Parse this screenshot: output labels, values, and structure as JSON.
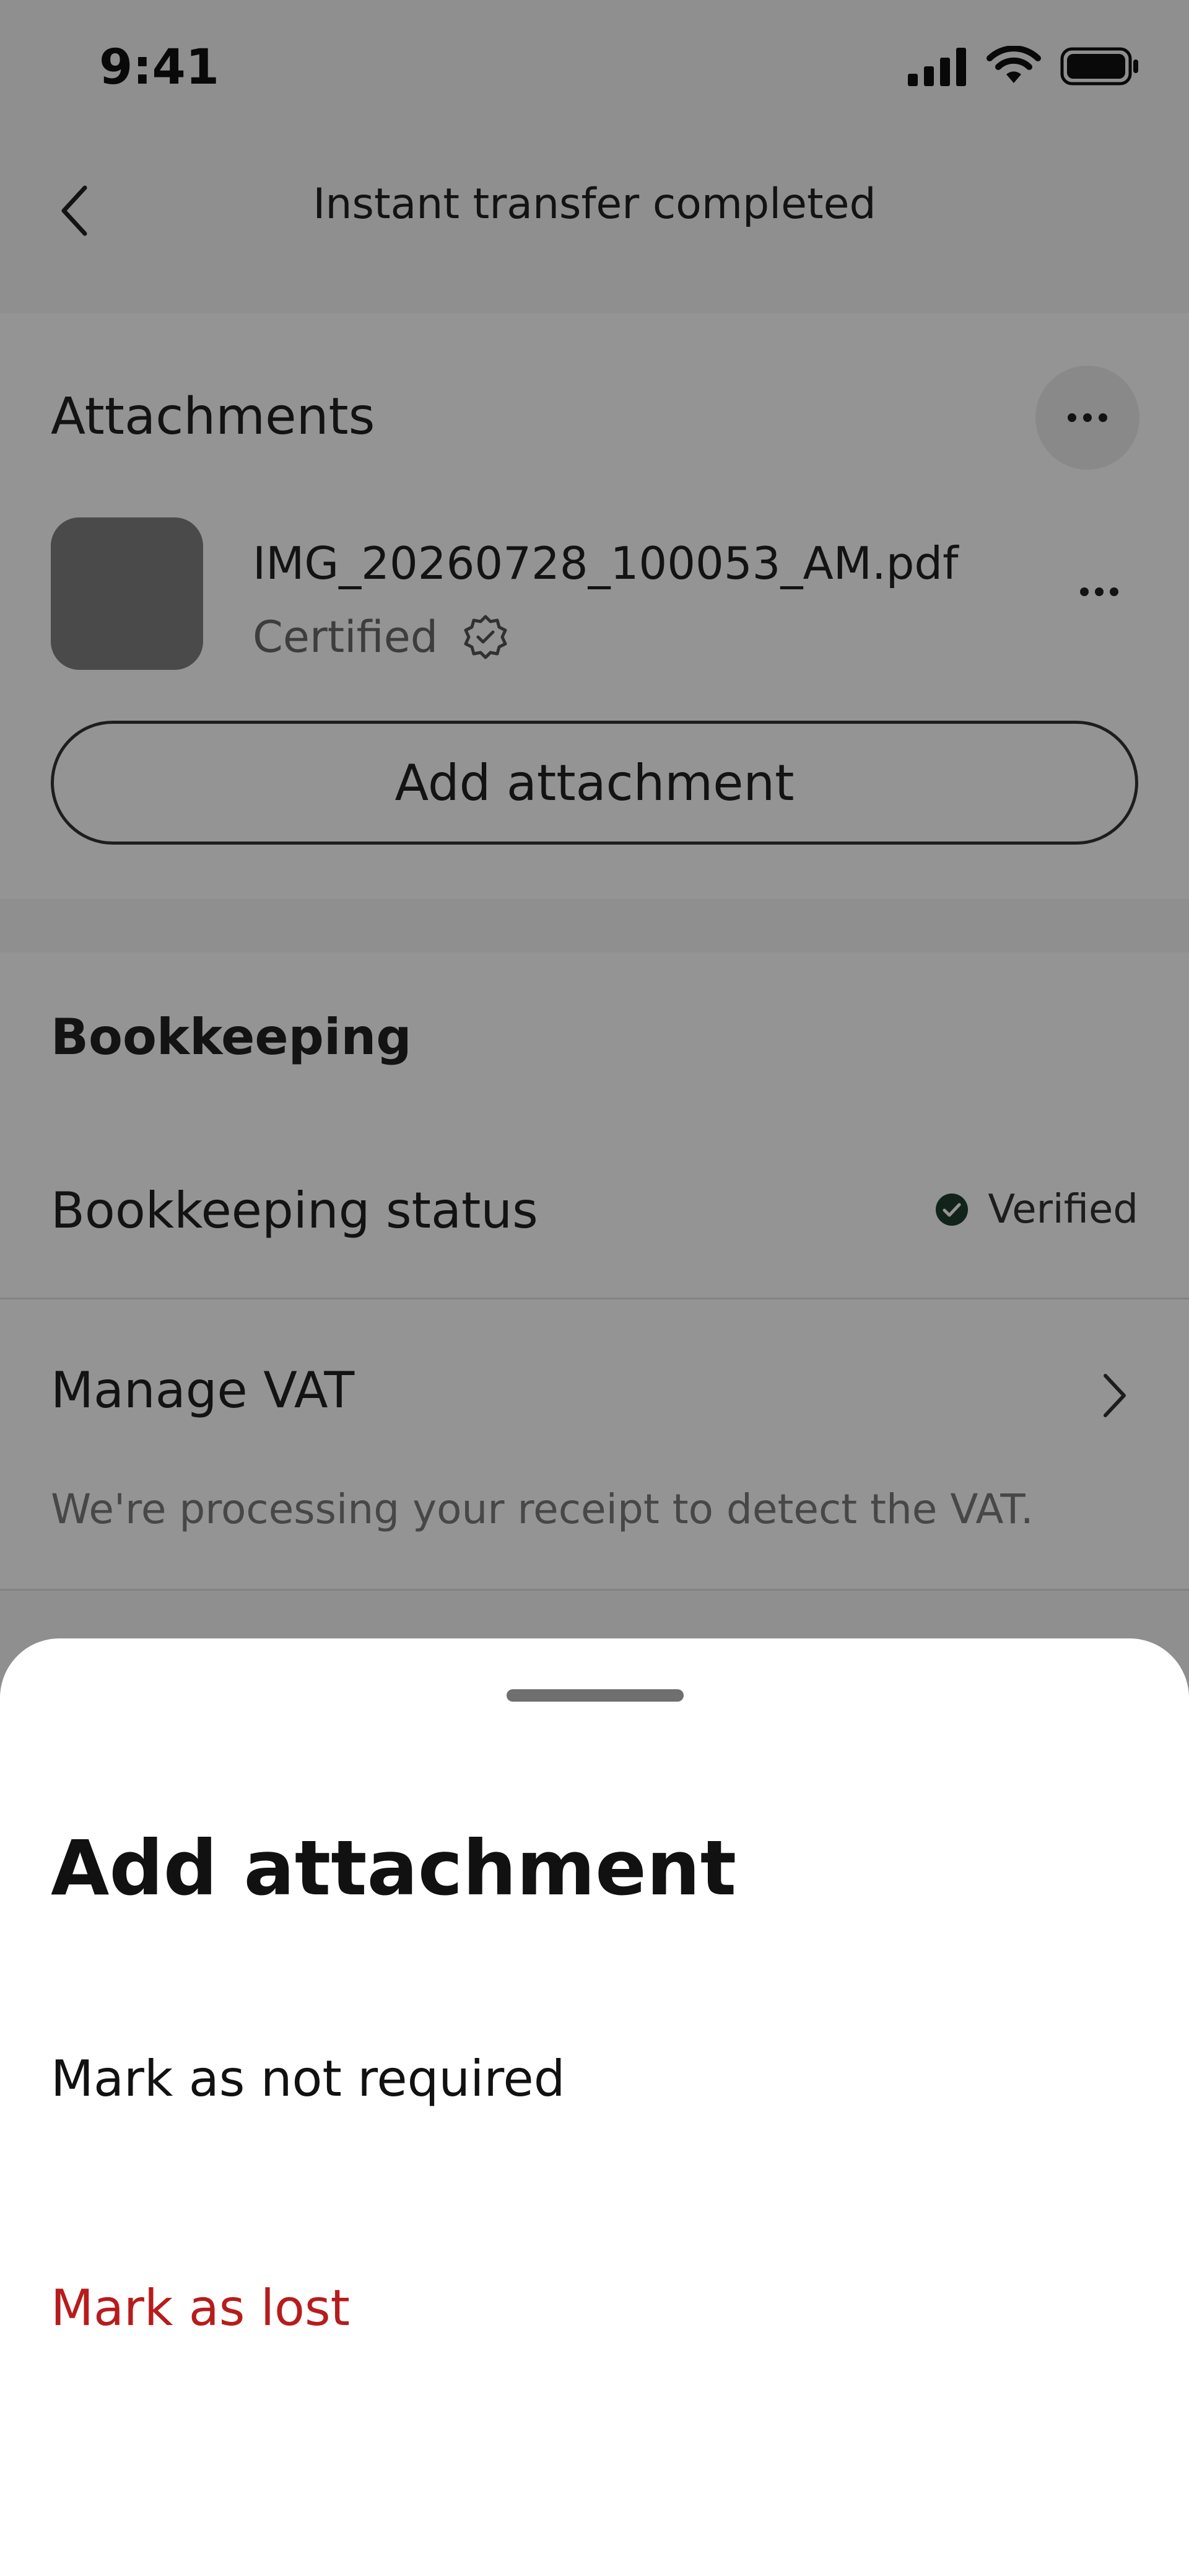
{
  "status_bar": {
    "time": "9:41"
  },
  "header": {
    "title": "Instant transfer completed"
  },
  "attachments": {
    "section_title": "Attachments",
    "file": {
      "name": "IMG_20260728_100053_AM.pdf",
      "status": "Certified"
    },
    "add_button": "Add attachment"
  },
  "bookkeeping": {
    "section_title": "Bookkeeping",
    "status_label": "Bookkeeping status",
    "status_value": "Verified",
    "vat_label": "Manage VAT",
    "vat_description": "We're processing your receipt to detect the VAT."
  },
  "sheet": {
    "title": "Add attachment",
    "items": [
      {
        "label": "Mark as not required"
      },
      {
        "label": "Mark as lost"
      }
    ]
  },
  "colors": {
    "danger": "#b71c1c",
    "verified": "#1f3d2e",
    "overlay": "#000000"
  },
  "icons": [
    "back-chevron-icon",
    "more-horizontal-icon",
    "certified-badge-icon",
    "check-circle-icon",
    "chevron-right-icon",
    "signal-icon",
    "wifi-icon",
    "battery-icon"
  ]
}
